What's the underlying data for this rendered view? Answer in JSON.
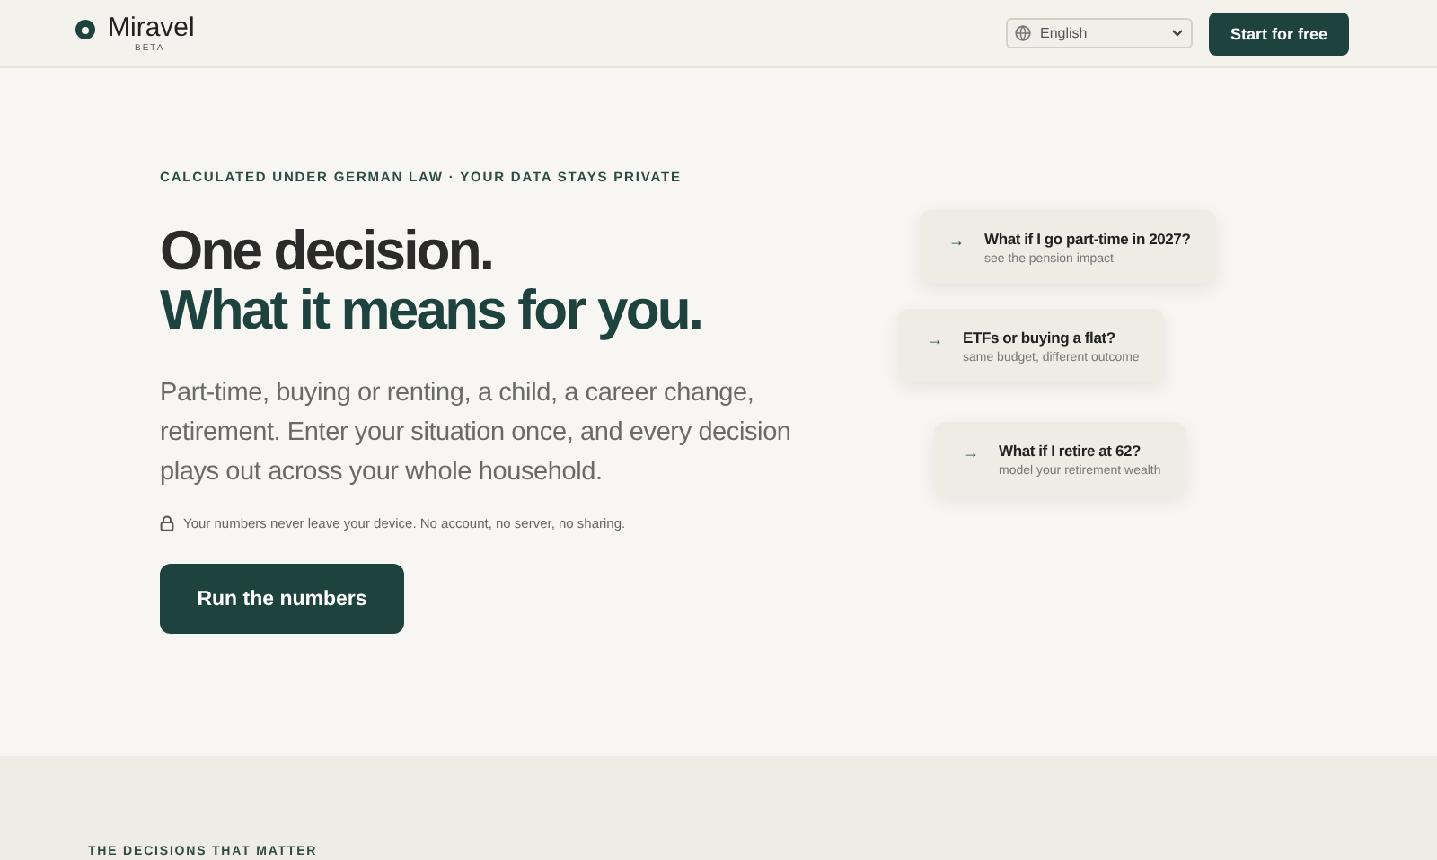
{
  "header": {
    "brand": "Miravel",
    "badge": "BETA",
    "language": "English",
    "cta": "Start for free"
  },
  "hero": {
    "eyebrow": "CALCULATED UNDER GERMAN LAW · YOUR DATA STAYS PRIVATE",
    "title_line_1": "One decision.",
    "title_line_2": "What it means for you.",
    "lead": "Part-time, buying or renting, a child, a career change, retirement. Enter your situation once, and every decision plays out across your whole household.",
    "privacy_note": "Your numbers never leave your device. No account, no server, no sharing.",
    "button": "Run the numbers"
  },
  "scenario_cards": [
    {
      "icon": "→",
      "title": "What if I go part-time in 2027?",
      "subtitle": "see the pension impact"
    },
    {
      "icon": "→",
      "title": "ETFs or buying a flat?",
      "subtitle": "same budget, different outcome"
    },
    {
      "icon": "→",
      "title": "What if I retire at 62?",
      "subtitle": "model your retirement wealth"
    }
  ],
  "next_section": {
    "eyebrow": "THE DECISIONS THAT MATTER"
  }
}
